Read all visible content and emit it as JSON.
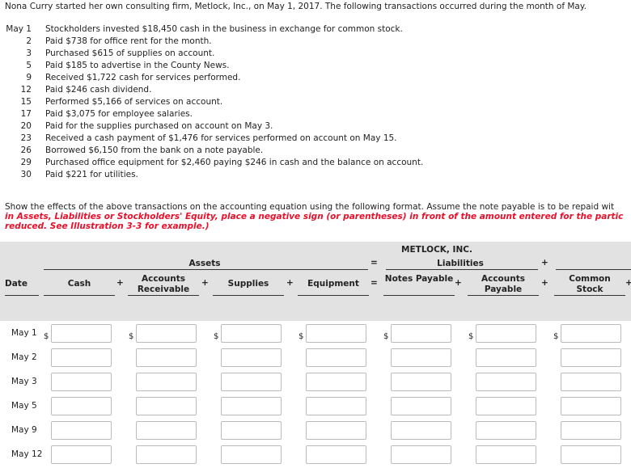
{
  "intro": "Nona Curry started her own consulting firm, Metlock, Inc., on May 1, 2017. The following transactions occurred during the month of May.",
  "transactions": [
    {
      "date": "May 1",
      "text": "Stockholders invested $18,450 cash in the business in exchange for common stock."
    },
    {
      "date": "2",
      "text": "Paid $738 for office rent for the month."
    },
    {
      "date": "3",
      "text": "Purchased $615 of supplies on account."
    },
    {
      "date": "5",
      "text": "Paid $185 to advertise in the County News."
    },
    {
      "date": "9",
      "text": "Received $1,722 cash for services performed."
    },
    {
      "date": "12",
      "text": "Paid $246 cash dividend."
    },
    {
      "date": "15",
      "text": "Performed $5,166 of services on account."
    },
    {
      "date": "17",
      "text": "Paid $3,075 for employee salaries."
    },
    {
      "date": "20",
      "text": "Paid for the supplies purchased on account on May 3."
    },
    {
      "date": "23",
      "text": "Received a cash payment of $1,476 for services performed on account on May 15."
    },
    {
      "date": "26",
      "text": "Borrowed $6,150 from the bank on a note payable."
    },
    {
      "date": "29",
      "text": "Purchased office equipment for $2,460 paying $246 in cash and the balance on account."
    },
    {
      "date": "30",
      "text": "Paid $221 for utilities."
    }
  ],
  "instructions": "Show the effects of the above transactions on the accounting equation using the following format. Assume the note payable is to be repaid wit",
  "instructions_red_1": "in Assets, Liabilities or Stockholders' Equity, place a negative sign (or parentheses) in front of the amount entered for the partic",
  "instructions_red_2": "reduced. See Illustration 3-3 for example.)",
  "table": {
    "company": "METLOCK, INC.",
    "assets": "Assets",
    "liabilities": "Liabilities",
    "eq": "=",
    "plus": "+",
    "date_header": "Date",
    "columns": [
      "Cash",
      "Accounts Receivable",
      "Supplies",
      "Equipment",
      "Notes Payable",
      "Accounts Payable",
      "Common Stock"
    ],
    "currency": "$",
    "rows": [
      "May 1",
      "May 2",
      "May 3",
      "May 5",
      "May 9",
      "May 12"
    ]
  }
}
